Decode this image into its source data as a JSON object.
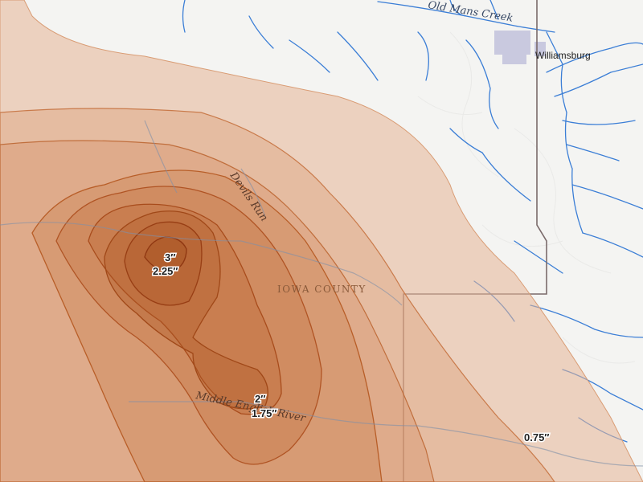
{
  "map": {
    "places": {
      "town": "Williamsburg",
      "county": "IOWA COUNTY"
    },
    "waterways": {
      "creek": "Old Mans Creek",
      "run": "Devils Run",
      "river": "Middle English River"
    },
    "contour_labels": {
      "peak_outer": "3″",
      "peak_inner": "2.25″",
      "south_upper": "2″",
      "south_lower": "1.75″",
      "east": "0.75″"
    },
    "colors": {
      "base": "#f4f4f2",
      "water": "#3b7ed6",
      "contour_fill": "#c8763f",
      "contour_line": "#b65a22",
      "boundary": "#7a6a6a"
    }
  }
}
